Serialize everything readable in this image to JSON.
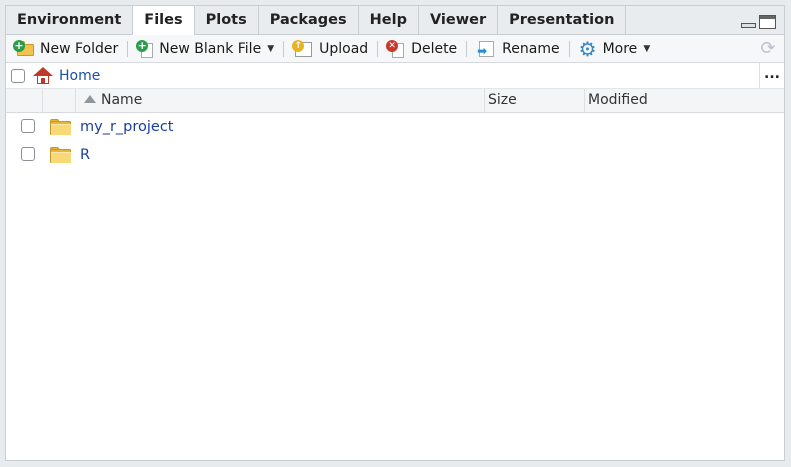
{
  "tabs": [
    {
      "label": "Environment",
      "active": false
    },
    {
      "label": "Files",
      "active": true
    },
    {
      "label": "Plots",
      "active": false
    },
    {
      "label": "Packages",
      "active": false
    },
    {
      "label": "Help",
      "active": false
    },
    {
      "label": "Viewer",
      "active": false
    },
    {
      "label": "Presentation",
      "active": false
    }
  ],
  "toolbar": {
    "new_folder": "New Folder",
    "new_blank_file": "New Blank File",
    "upload": "Upload",
    "delete": "Delete",
    "rename": "Rename",
    "more": "More"
  },
  "breadcrumb": {
    "home": "Home",
    "more_path": "..."
  },
  "table": {
    "headers": {
      "name": "Name",
      "size": "Size",
      "modified": "Modified"
    },
    "sort": "name-ascending",
    "rows": [
      {
        "name": "my_r_project",
        "type": "folder",
        "size": "",
        "modified": ""
      },
      {
        "name": "R",
        "type": "folder",
        "size": "",
        "modified": ""
      }
    ]
  },
  "colors": {
    "link": "#1c4fa8",
    "folder": "#e7b53b",
    "add_badge": "#2a9d4b",
    "delete_badge": "#c73a2b",
    "home": "#c0392b"
  }
}
